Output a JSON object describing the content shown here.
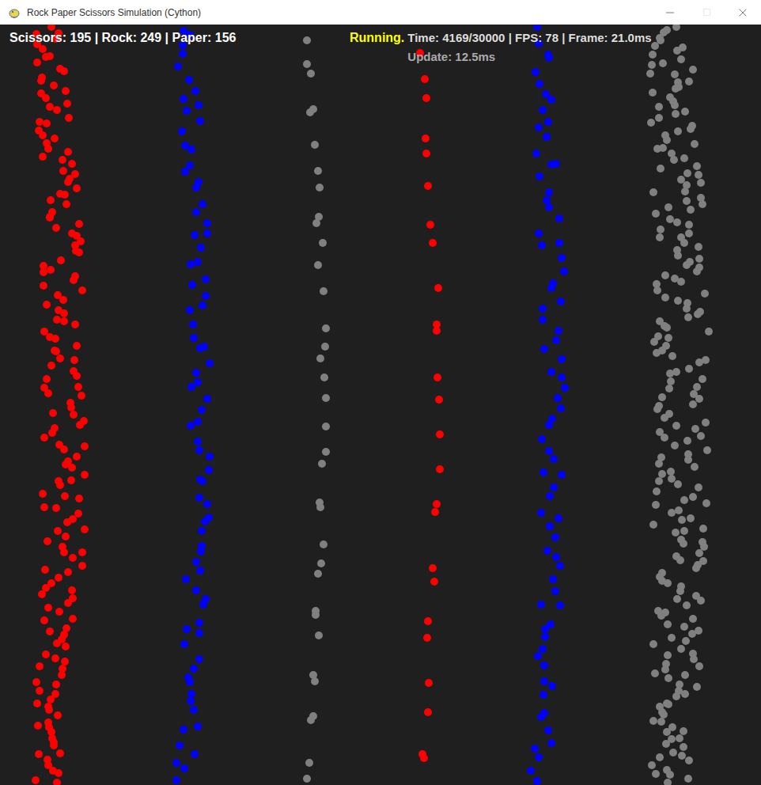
{
  "window": {
    "title": "Rock Paper Scissors Simulation (Cython)",
    "controls": [
      {
        "kind": "minimize",
        "disabled": false
      },
      {
        "kind": "maximize",
        "disabled": true
      },
      {
        "kind": "close",
        "disabled": false
      }
    ]
  },
  "hud": {
    "counts": "Scissors: 195 | Rock: 249 | Paper: 156",
    "status": "Running.",
    "stats": "Time: 4169/30000 | FPS: 78 | Frame: 21.0ms",
    "update": "Update: 12.5ms"
  },
  "particles": [
    {
      "kind": "scissors",
      "color": "#ff0000",
      "count": 170
    },
    {
      "kind": "paper",
      "color": "#0000ff",
      "count": 80
    },
    {
      "kind": "rock",
      "color": "#808080",
      "count": 35
    },
    {
      "kind": "scissors",
      "color": "#ff0000",
      "count": 25
    },
    {
      "kind": "paper",
      "color": "#0000ff",
      "count": 76
    },
    {
      "kind": "rock",
      "color": "#808080",
      "count": 214
    }
  ]
}
